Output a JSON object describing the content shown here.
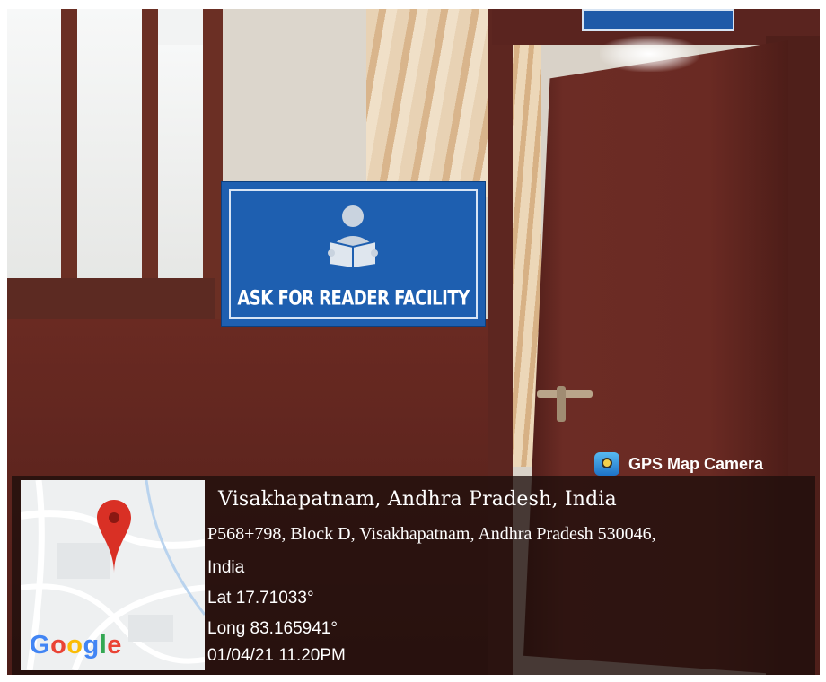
{
  "sign": {
    "text": "ASK FOR READER FACILITY"
  },
  "gps": {
    "brand": "GPS Map Camera",
    "location_title": "Visakhapatnam,  Andhra Pradesh, India",
    "address_line1": "P568+798, Block D, Visakhapatnam,  Andhra  Pradesh 530046,",
    "address_line2": "India",
    "lat": "Lat 17.71033°",
    "long": "Long 83.165941°",
    "datetime": "01/04/21 11.20PM",
    "map_logo": "Google",
    "pin_color": "#d93025"
  },
  "icons": [
    "reader-icon",
    "gps-camera-logo-icon",
    "map-pin-icon"
  ]
}
